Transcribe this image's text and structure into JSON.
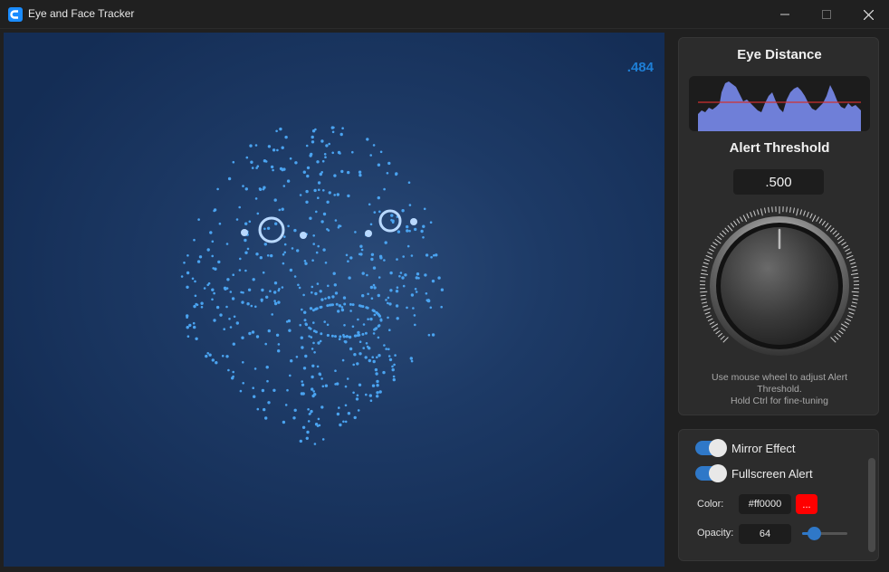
{
  "window": {
    "title": "Eye and Face Tracker",
    "controls": [
      "minimize",
      "maximize",
      "close"
    ]
  },
  "viewport": {
    "distance_readout": ".484"
  },
  "eye_distance": {
    "heading": "Eye Distance",
    "line_color": "#d03030",
    "fill_color": "#6f7fd8"
  },
  "alert_threshold": {
    "heading": "Alert Threshold",
    "value": ".500",
    "hint_line1": "Use mouse wheel to adjust Alert",
    "hint_line2": "Threshold.",
    "hint_line3": "Hold Ctrl for fine-tuning"
  },
  "settings": {
    "mirror_effect": {
      "label": "Mirror Effect",
      "on": true
    },
    "fullscreen_alert": {
      "label": "Fullscreen Alert",
      "on": true
    },
    "color": {
      "label": "Color:",
      "value": "#ff0000",
      "swatch_label": "..."
    },
    "opacity": {
      "label": "Opacity:",
      "value": "64",
      "percent": 25
    }
  },
  "colors": {
    "accent": "#2f78c8",
    "mesh_point": "#4aa3f0",
    "eye_ring": "#b9d9ff"
  }
}
